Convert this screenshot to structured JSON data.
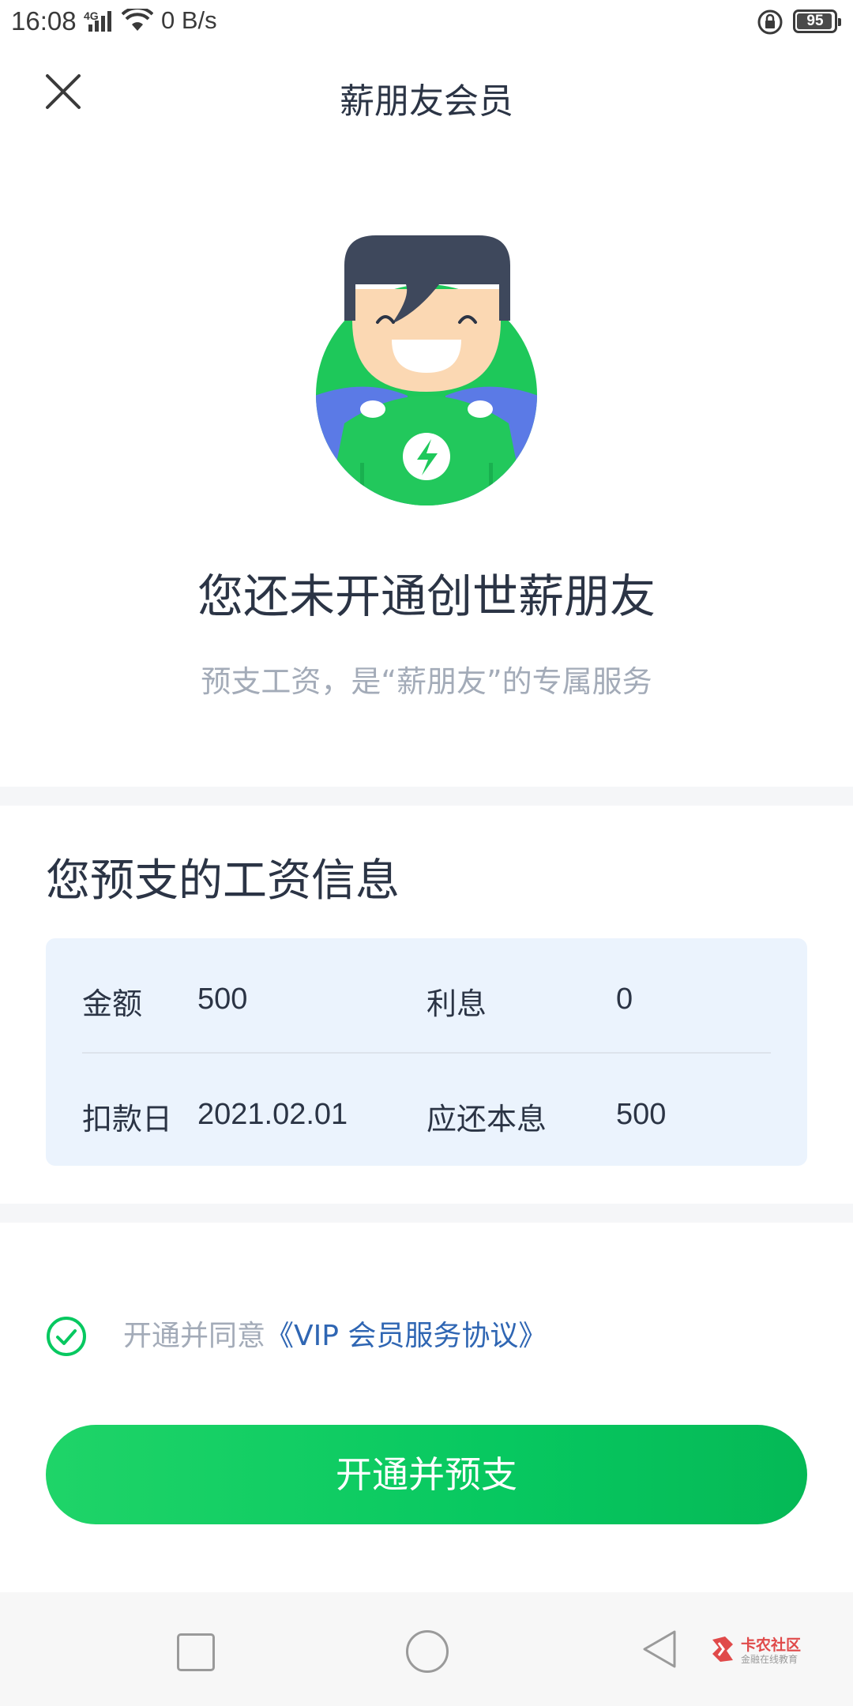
{
  "status_bar": {
    "time": "16:08",
    "network": "4G",
    "speed": "0 B/s",
    "battery": "95",
    "battery_level": 0.95
  },
  "header": {
    "title": "薪朋友会员",
    "close_icon": "close-icon"
  },
  "hero": {
    "avatar_icon": "member-avatar-illustration",
    "title": "您还未开通创世薪朋友",
    "subtitle": "预支工资，是“薪朋友”的专属服务"
  },
  "salary_info": {
    "title": "您预支的工资信息",
    "amount_label": "金额",
    "amount_value": "500",
    "interest_label": "利息",
    "interest_value": "0",
    "deduction_date_label": "扣款日",
    "deduction_date_value": "2021.02.01",
    "repay_label": "应还本息",
    "repay_value": "500"
  },
  "agreement": {
    "checked": true,
    "prefix": "开通并同意",
    "link": "《VIP 会员服务协议》"
  },
  "action": {
    "button_label": "开通并预支"
  },
  "nav": {
    "recent_icon": "square-icon",
    "home_icon": "circle-icon",
    "back_icon": "triangle-back-icon"
  },
  "watermark": {
    "title": "卡农社区",
    "subtitle": "金融在线教育"
  },
  "colors": {
    "accent_green": "#07c860",
    "link_blue": "#2f66b3",
    "card_bg": "#ebf3fd"
  }
}
